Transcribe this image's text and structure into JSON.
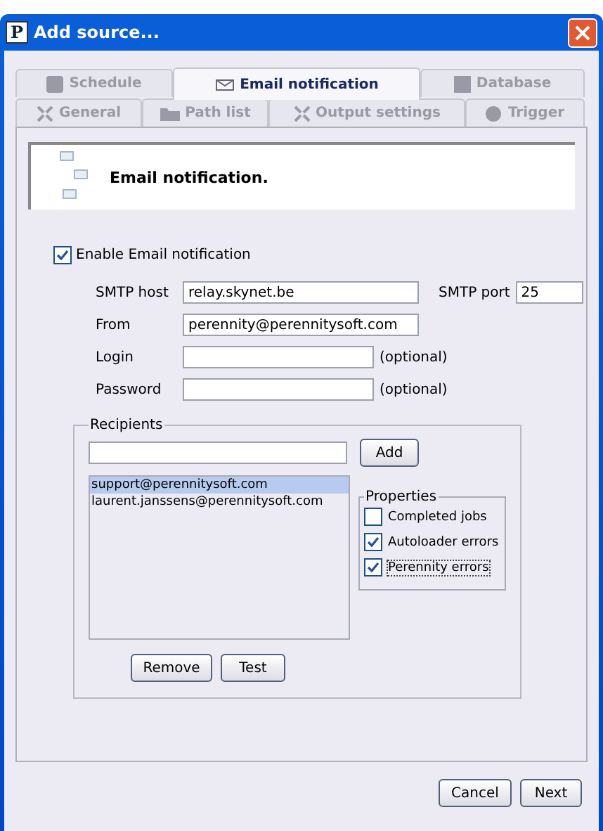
{
  "window": {
    "title": "Add source...",
    "icon_letter": "P"
  },
  "tab_rows": [
    [
      {
        "label": "Schedule",
        "selected": false
      },
      {
        "label": "Email notification",
        "selected": true
      },
      {
        "label": "Database",
        "selected": false
      }
    ],
    [
      {
        "label": "General",
        "selected": false
      },
      {
        "label": "Path list",
        "selected": false
      },
      {
        "label": "Output settings",
        "selected": false
      },
      {
        "label": "Trigger",
        "selected": false
      }
    ]
  ],
  "header": {
    "title": "Email notification."
  },
  "enable": {
    "label": "Enable Email notification",
    "checked": true
  },
  "fields": [
    {
      "label": "SMTP host",
      "value": "relay.skynet.be"
    },
    {
      "label": "From",
      "value": "perennity@perennitysoft.com"
    },
    {
      "label": "Login",
      "note": "(optional)"
    },
    {
      "label": "Password",
      "note": "(optional)"
    }
  ],
  "port": {
    "label": "SMTP port",
    "value": "25"
  },
  "recipients": {
    "title": "Recipients",
    "add": "Add",
    "items": [
      {
        "text": "support@perennitysoft.com",
        "selected": true
      },
      {
        "text": "laurent.janssens@perennitysoft.com",
        "selected": false
      }
    ],
    "buttons": [
      "Remove",
      "Test"
    ]
  },
  "properties": {
    "title": "Properties",
    "items": [
      {
        "label": "Completed jobs",
        "checked": false,
        "focused": false
      },
      {
        "label": "Autoloader errors",
        "checked": true,
        "focused": false
      },
      {
        "label": "Perennity errors",
        "checked": true,
        "focused": true
      }
    ]
  },
  "footer_buttons": [
    "Cancel",
    "Next"
  ]
}
